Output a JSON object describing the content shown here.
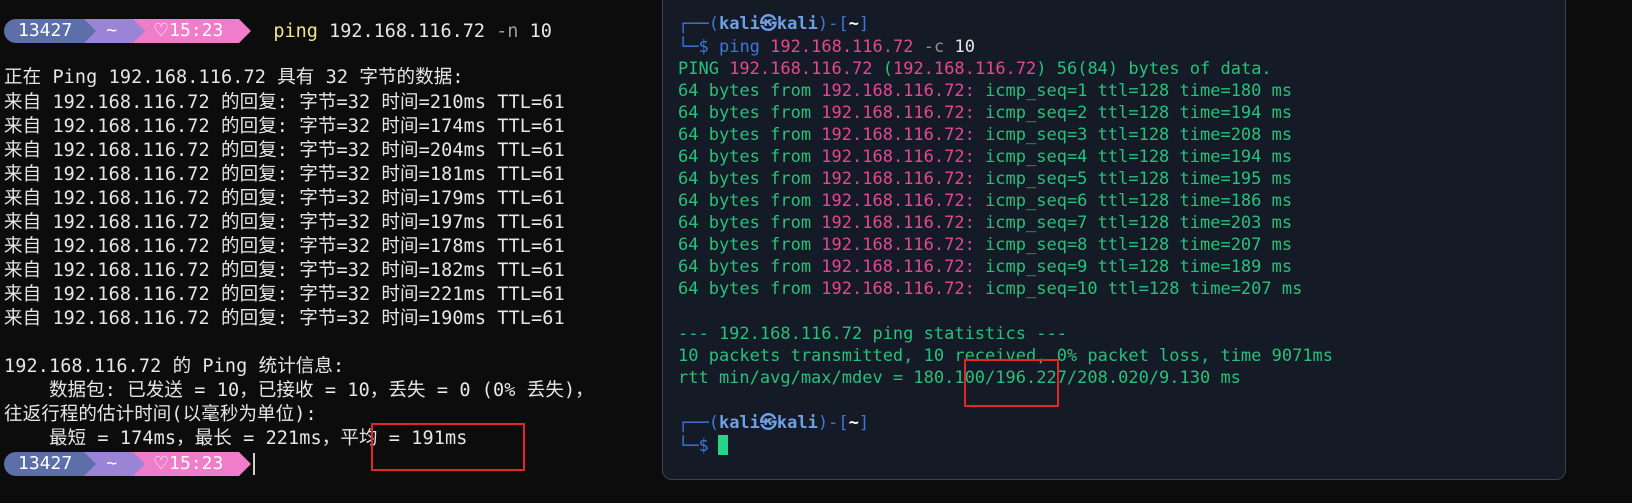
{
  "windows_terminal": {
    "prompt_top": {
      "history_number": "13427",
      "directory": "~",
      "time": "15:23",
      "heart": "♡"
    },
    "command": {
      "name": "ping",
      "args": "192.168.116.72",
      "flag": "-n",
      "count": "10"
    },
    "header_line": "正在 Ping 192.168.116.72 具有 32 字节的数据:",
    "replies": [
      "来自 192.168.116.72 的回复: 字节=32 时间=210ms TTL=61",
      "来自 192.168.116.72 的回复: 字节=32 时间=174ms TTL=61",
      "来自 192.168.116.72 的回复: 字节=32 时间=204ms TTL=61",
      "来自 192.168.116.72 的回复: 字节=32 时间=181ms TTL=61",
      "来自 192.168.116.72 的回复: 字节=32 时间=179ms TTL=61",
      "来自 192.168.116.72 的回复: 字节=32 时间=197ms TTL=61",
      "来自 192.168.116.72 的回复: 字节=32 时间=178ms TTL=61",
      "来自 192.168.116.72 的回复: 字节=32 时间=182ms TTL=61",
      "来自 192.168.116.72 的回复: 字节=32 时间=221ms TTL=61",
      "来自 192.168.116.72 的回复: 字节=32 时间=190ms TTL=61"
    ],
    "stats_title": "192.168.116.72 的 Ping 统计信息:",
    "stats_packets": "    数据包: 已发送 = 10，已接收 = 10，丢失 = 0 (0% 丢失)，",
    "stats_rtt_title": "往返行程的估计时间(以毫秒为单位):",
    "stats_rtt": "    最短 = 174ms，最长 = 221ms，平均 = 191ms",
    "prompt_bottom": {
      "history_number": "13427",
      "directory": "~",
      "time": "15:23",
      "heart": "♡"
    }
  },
  "kali_terminal": {
    "prompt_user": "kali",
    "prompt_at": "㉿",
    "prompt_host": "kali",
    "prompt_dir": "~",
    "command": {
      "name": "ping",
      "ip": "192.168.116.72",
      "flag": "-c",
      "count": "10"
    },
    "ping_header": {
      "prefix": "PING ",
      "ip": "192.168.116.72",
      "paren_open": " (",
      "ip2": "192.168.116.72",
      "suffix": ") 56(84) bytes of data."
    },
    "replies": [
      {
        "prefix": "64 bytes from ",
        "ip": "192.168.116.72:",
        "rest": " icmp_seq=1 ttl=128 time=180 ms"
      },
      {
        "prefix": "64 bytes from ",
        "ip": "192.168.116.72:",
        "rest": " icmp_seq=2 ttl=128 time=194 ms"
      },
      {
        "prefix": "64 bytes from ",
        "ip": "192.168.116.72:",
        "rest": " icmp_seq=3 ttl=128 time=208 ms"
      },
      {
        "prefix": "64 bytes from ",
        "ip": "192.168.116.72:",
        "rest": " icmp_seq=4 ttl=128 time=194 ms"
      },
      {
        "prefix": "64 bytes from ",
        "ip": "192.168.116.72:",
        "rest": " icmp_seq=5 ttl=128 time=195 ms"
      },
      {
        "prefix": "64 bytes from ",
        "ip": "192.168.116.72:",
        "rest": " icmp_seq=6 ttl=128 time=186 ms"
      },
      {
        "prefix": "64 bytes from ",
        "ip": "192.168.116.72:",
        "rest": " icmp_seq=7 ttl=128 time=203 ms"
      },
      {
        "prefix": "64 bytes from ",
        "ip": "192.168.116.72:",
        "rest": " icmp_seq=8 ttl=128 time=207 ms"
      },
      {
        "prefix": "64 bytes from ",
        "ip": "192.168.116.72:",
        "rest": " icmp_seq=9 ttl=128 time=189 ms"
      },
      {
        "prefix": "64 bytes from ",
        "ip": "192.168.116.72:",
        "rest": " icmp_seq=10 ttl=128 time=207 ms"
      }
    ],
    "stats_header": "--- 192.168.116.72 ping statistics ---",
    "stats_packets": "10 packets transmitted, 10 received, 0% packet loss, time 9071ms",
    "stats_rtt": "rtt min/avg/max/mdev = 180.100/196.227/208.020/9.130 ms"
  },
  "colors": {
    "highlight_box": "#e62328",
    "kali_green": "#26c17a",
    "kali_ip_pink": "#e44892",
    "kali_prompt_blue": "#3c78d8",
    "prompt_number_bg": "#5d6fa8",
    "prompt_dir_bg": "#9b83d6",
    "prompt_time_bg": "#f07dc9"
  }
}
